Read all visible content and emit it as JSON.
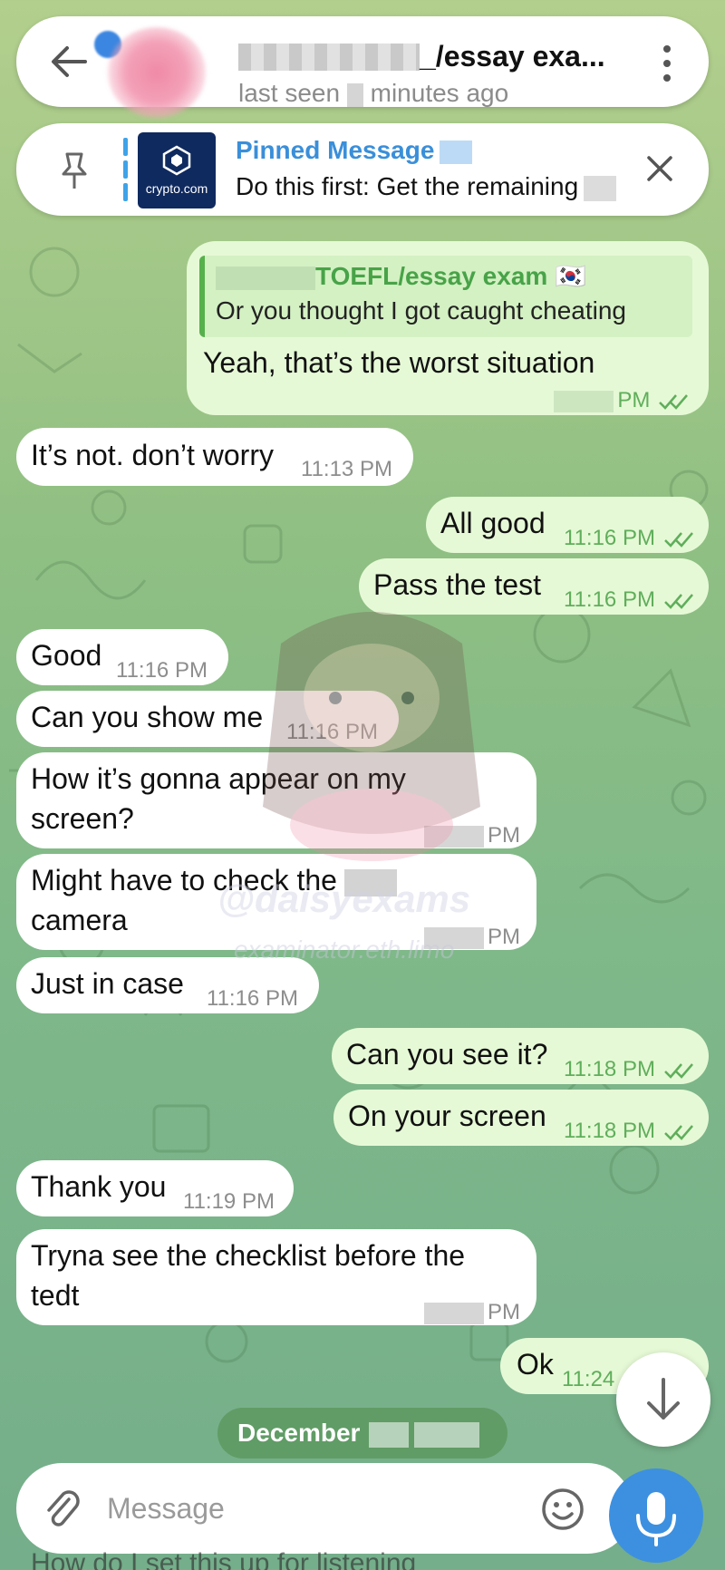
{
  "header": {
    "back_icon": "arrow-left-icon",
    "title_suffix": "_/essay exa...",
    "subtitle_prefix": "last seen",
    "subtitle_suffix": "minutes ago",
    "menu_icon": "vertical-dots-icon"
  },
  "pinned": {
    "pin_icon": "pin-icon",
    "thumb_label": "crypto.com",
    "title": "Pinned Message",
    "text": "Do this first: Get the remaining",
    "close_icon": "close-icon"
  },
  "messages": [
    {
      "dir": "out",
      "reply_name": "TOEFL/essay exam 🇰🇷",
      "reply_text": "Or you thought I got caught cheating",
      "text": "Yeah, that’s the worst situation",
      "time": "PM"
    },
    {
      "dir": "in",
      "text": "It’s not. don’t worry",
      "time": "11:13 PM"
    },
    {
      "dir": "out",
      "text": "All good",
      "time": "11:16 PM"
    },
    {
      "dir": "out",
      "text": "Pass the test",
      "time": "11:16 PM"
    },
    {
      "dir": "in",
      "text": "Good",
      "time": "11:16 PM"
    },
    {
      "dir": "in",
      "text": "Can you show me",
      "time": "11:16 PM"
    },
    {
      "dir": "in",
      "text": "How it’s gonna appear on my screen?",
      "time": "PM"
    },
    {
      "dir": "in",
      "text": "Might have to check the",
      "text2": "camera",
      "time": "PM"
    },
    {
      "dir": "in",
      "text": "Just in case",
      "time": "11:16 PM"
    },
    {
      "dir": "out",
      "text": "Can you see it?",
      "time": "11:18 PM"
    },
    {
      "dir": "out",
      "text": "On your screen",
      "time": "11:18 PM"
    },
    {
      "dir": "in",
      "text": "Thank you",
      "time": "11:19 PM"
    },
    {
      "dir": "in",
      "text": "Tryna see the checklist before the tedt",
      "time": "PM"
    },
    {
      "dir": "out",
      "text": "Ok",
      "time": "11:24"
    }
  ],
  "date_divider": "December",
  "watermark": {
    "handle": "@daisyexams",
    "site": "examinator.eth.limo"
  },
  "input": {
    "placeholder": "Message",
    "attach_icon": "paperclip-icon",
    "emoji_icon": "emoji-icon",
    "mic_icon": "microphone-icon"
  },
  "scroll_icon": "arrow-down-icon",
  "bottom_peek": "How do I set this up for listening"
}
